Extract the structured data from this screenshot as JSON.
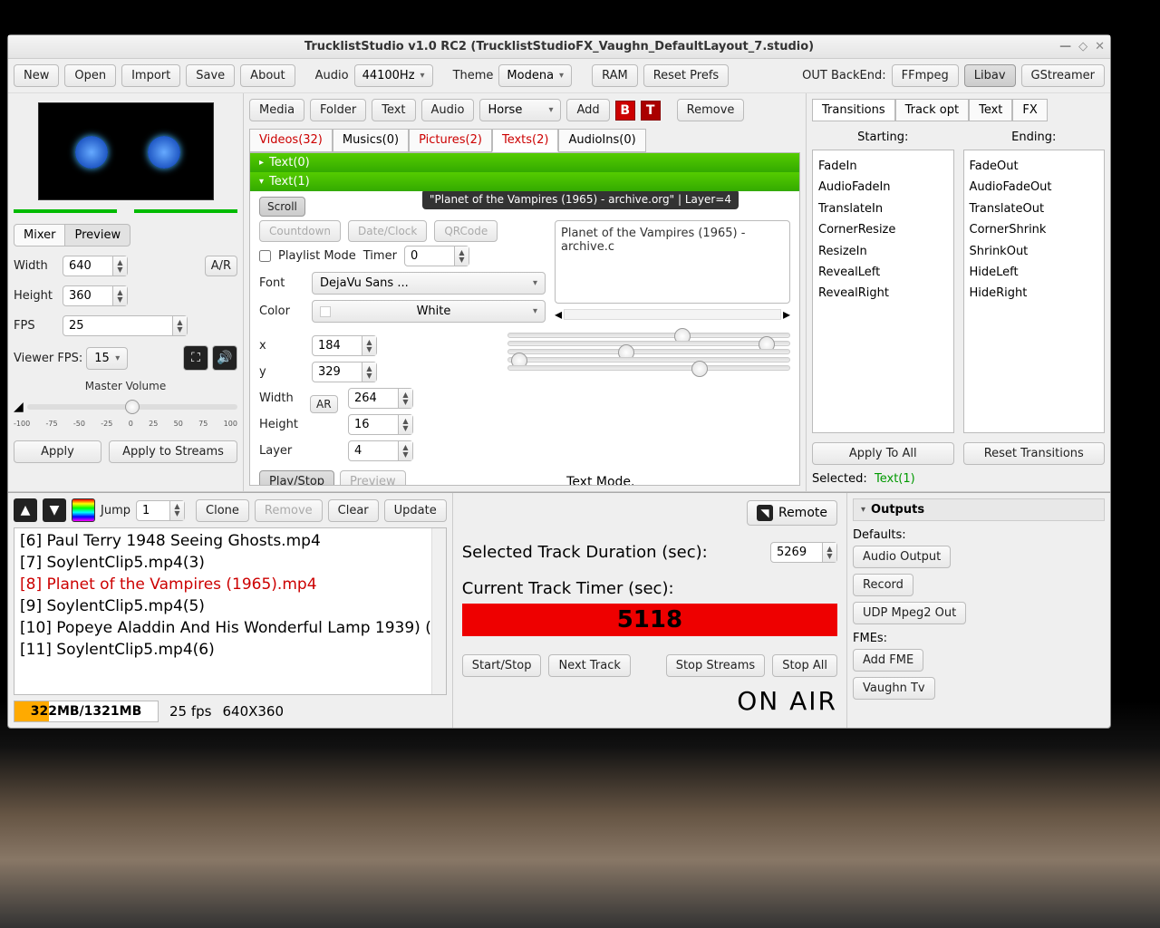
{
  "title": "TrucklistStudio v1.0 RC2 (TrucklistStudioFX_Vaughn_DefaultLayout_7.studio)",
  "toolbar": {
    "new": "New",
    "open": "Open",
    "import": "Import",
    "save": "Save",
    "about": "About",
    "audio": "Audio",
    "audio_rate": "44100Hz",
    "theme": "Theme",
    "theme_val": "Modena",
    "ram": "RAM",
    "reset": "Reset Prefs",
    "backend_label": "OUT BackEnd:",
    "ffmpeg": "FFmpeg",
    "libav": "Libav",
    "gstreamer": "GStreamer"
  },
  "left": {
    "mixer": "Mixer",
    "preview": "Preview",
    "width": "Width",
    "width_val": "640",
    "height": "Height",
    "height_val": "360",
    "ar": "A/R",
    "fps": "FPS",
    "fps_val": "25",
    "viewer": "Viewer FPS:",
    "viewer_val": "15",
    "mastervol": "Master Volume",
    "apply": "Apply",
    "applystreams": "Apply to Streams",
    "ticks": [
      "-100",
      "-75",
      "-50",
      "-25",
      "0",
      "25",
      "50",
      "75",
      "100"
    ]
  },
  "mid": {
    "media": "Media",
    "folder": "Folder",
    "text": "Text",
    "audio": "Audio",
    "horse": "Horse",
    "add": "Add",
    "remove": "Remove",
    "tabs": [
      "Videos(32)",
      "Musics(0)",
      "Pictures(2)",
      "Texts(2)",
      "AudioIns(0)"
    ],
    "acc0": "Text(0)",
    "acc1": "Text(1)",
    "tooltip": "\"Planet of the Vampires (1965) - archive.org\" | Layer=4",
    "scroll": "Scroll",
    "countdown": "Countdown",
    "dateclock": "Date/Clock",
    "qrcode": "QRCode",
    "playlistmode": "Playlist Mode",
    "timer": "Timer",
    "timer_val": "0",
    "font": "Font",
    "font_val": "DejaVu Sans ...",
    "color": "Color",
    "color_val": "White",
    "textarea": "Planet of the Vampires (1965) - archive.c",
    "x": "x",
    "x_val": "184",
    "y": "y",
    "y_val": "329",
    "pwidth": "Width",
    "pwidth_val": "264",
    "pheight": "Height",
    "pheight_val": "16",
    "layer": "Layer",
    "layer_val": "4",
    "ar": "AR",
    "playstop": "Play/Stop",
    "preview": "Preview",
    "textmode": "Text Mode."
  },
  "right": {
    "tabs": [
      "Transitions",
      "Track opt",
      "Text",
      "FX"
    ],
    "starting": "Starting:",
    "ending": "Ending:",
    "start_list": [
      "FadeIn",
      "AudioFadeIn",
      "TranslateIn",
      "CornerResize",
      "ResizeIn",
      "RevealLeft",
      "RevealRight"
    ],
    "end_list": [
      "FadeOut",
      "AudioFadeOut",
      "TranslateOut",
      "CornerShrink",
      "ShrinkOut",
      "HideLeft",
      "HideRight"
    ],
    "applyall": "Apply To All",
    "resettr": "Reset Transitions",
    "selected": "Selected:",
    "selected_val": "Text(1)"
  },
  "bottom": {
    "jump": "Jump",
    "jump_val": "1",
    "clone": "Clone",
    "remove": "Remove",
    "clear": "Clear",
    "update": "Update",
    "playlist": [
      "[6] Paul Terry 1948 Seeing Ghosts.mp4",
      "[7] SoylentClip5.mp4(3)",
      "[8] Planet of the Vampires (1965).mp4",
      "[9] SoylentClip5.mp4(5)",
      "[10] Popeye Aladdin And His Wonderful Lamp 1939) (",
      "[11] SoylentClip5.mp4(6)"
    ],
    "mem": "322MB/1321MB",
    "fps": "25 fps",
    "res": "640X360",
    "remote": "Remote",
    "dur_label": "Selected Track Duration (sec):",
    "dur_val": "5269",
    "timer_label": "Current Track Timer (sec):",
    "timer_val": "5118",
    "startstop": "Start/Stop",
    "next": "Next Track",
    "stopstreams": "Stop Streams",
    "stopall": "Stop All",
    "onair": "ON AIR"
  },
  "outputs": {
    "hdr": "Outputs",
    "defaults": "Defaults:",
    "audio": "Audio Output",
    "record": "Record",
    "udp": "UDP Mpeg2 Out",
    "fmes": "FMEs:",
    "addfme": "Add FME",
    "vaughn": "Vaughn Tv"
  }
}
